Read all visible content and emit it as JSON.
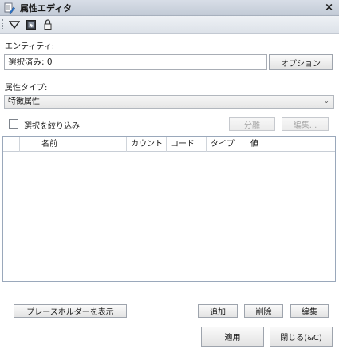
{
  "window": {
    "title": "属性エディタ",
    "close_glyph": "×"
  },
  "toolbar": {
    "icons": [
      "filter-dropdown-icon",
      "select-entity-icon",
      "lock-icon"
    ]
  },
  "entity": {
    "label": "エンティティ:",
    "value": "選択済み: 0",
    "options_button": "オプション"
  },
  "attribute_type": {
    "label": "属性タイプ:",
    "selected": "特徴属性"
  },
  "filter": {
    "checkbox_label": "選択を絞り込み",
    "checked": false,
    "split_button": "分離",
    "edit_button": "編集..."
  },
  "grid": {
    "columns": [
      "名前",
      "カウント",
      "コード",
      "タイプ",
      "値"
    ],
    "rows": []
  },
  "actions": {
    "show_placeholder": "プレースホルダーを表示",
    "add": "追加",
    "delete": "削除",
    "edit": "編集",
    "apply": "適用",
    "close": "閉じる(&C)"
  },
  "colors": {
    "titlebar": "#c8d0db",
    "toolbar": "#e4e8ee",
    "grid_border": "#9aa8bb",
    "disabled_text": "#a4a4a4"
  }
}
